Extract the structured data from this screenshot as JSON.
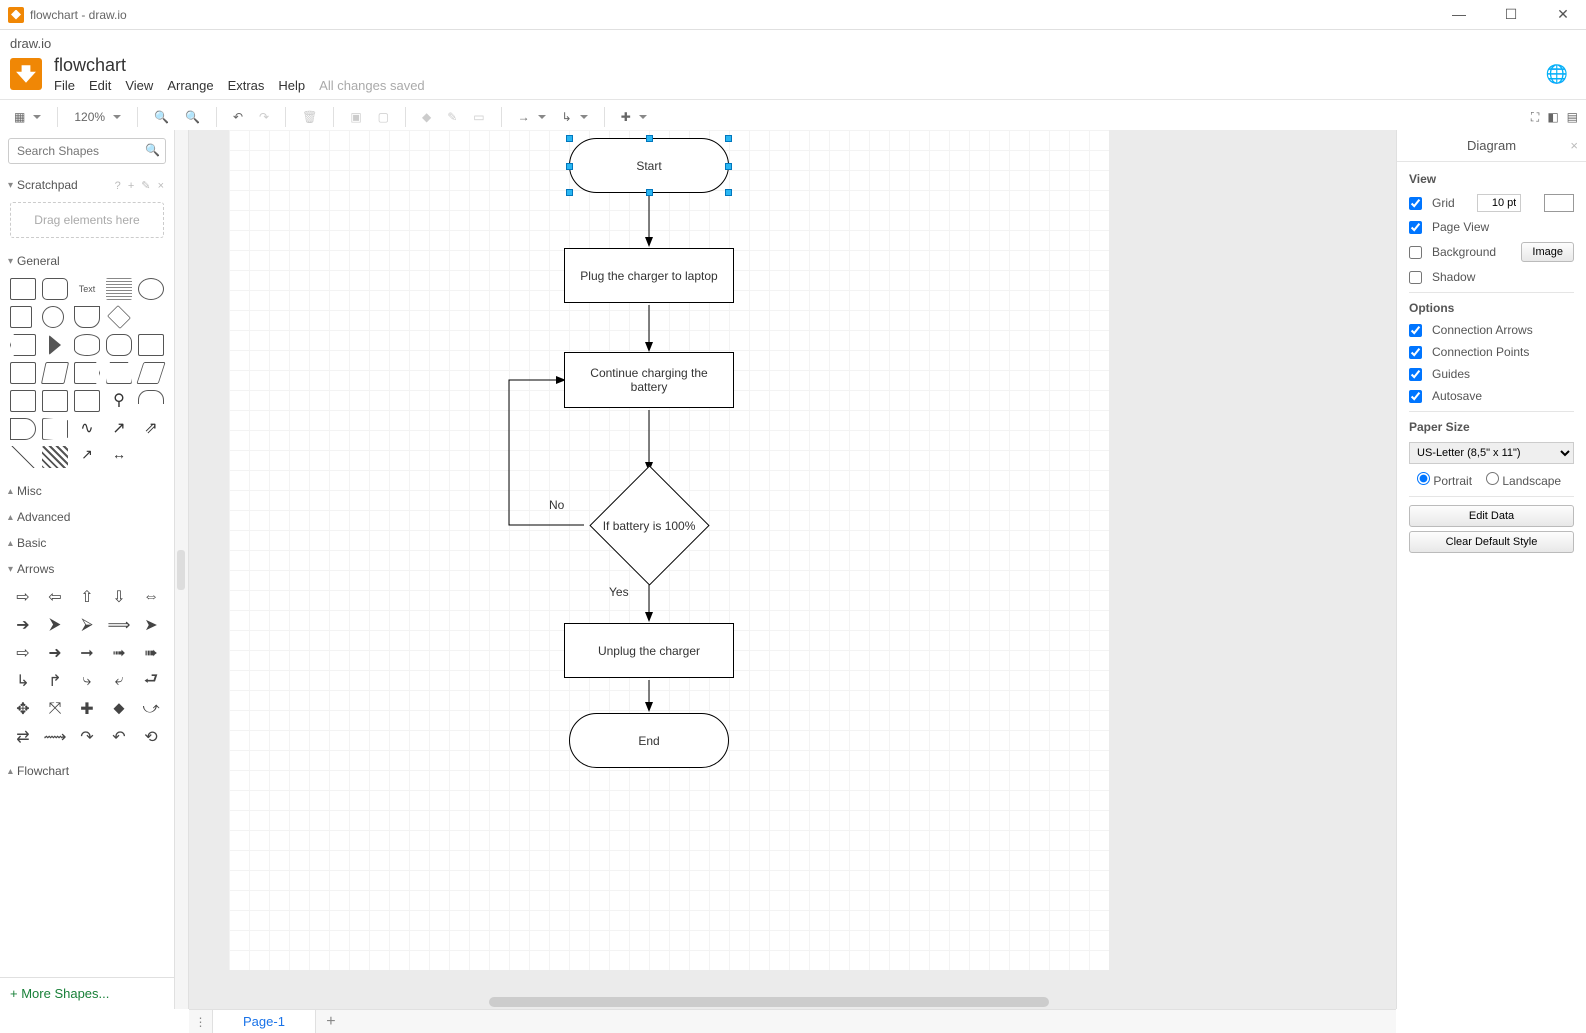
{
  "window": {
    "title": "flowchart - draw.io"
  },
  "breadcrumb": "draw.io",
  "document": {
    "title": "flowchart"
  },
  "menu": {
    "items": [
      "File",
      "Edit",
      "View",
      "Arrange",
      "Extras",
      "Help"
    ],
    "saved": "All changes saved"
  },
  "toolbar": {
    "zoom": "120%"
  },
  "sidebar": {
    "search_placeholder": "Search Shapes",
    "scratchpad": {
      "label": "Scratchpad",
      "hint": "Drag elements here",
      "tools": "? + ✎ ×"
    },
    "sections": {
      "general": "General",
      "misc": "Misc",
      "advanced": "Advanced",
      "basic": "Basic",
      "arrows": "Arrows",
      "flowchart": "Flowchart"
    },
    "more_shapes": "More Shapes..."
  },
  "diagram": {
    "nodes": {
      "start": "Start",
      "plug": "Plug the charger to laptop",
      "continue": "Continue charging the battery",
      "decision": "If battery is 100%",
      "unplug": "Unplug the charger",
      "end": "End"
    },
    "labels": {
      "no": "No",
      "yes": "Yes"
    }
  },
  "right_panel": {
    "title": "Diagram",
    "view": {
      "heading": "View",
      "grid": "Grid",
      "grid_value": "10 pt",
      "page_view": "Page View",
      "background": "Background",
      "image_btn": "Image",
      "shadow": "Shadow"
    },
    "options": {
      "heading": "Options",
      "conn_arrows": "Connection Arrows",
      "conn_points": "Connection Points",
      "guides": "Guides",
      "autosave": "Autosave"
    },
    "paper": {
      "heading": "Paper Size",
      "value": "US-Letter (8,5\" x 11\")",
      "portrait": "Portrait",
      "landscape": "Landscape"
    },
    "buttons": {
      "edit_data": "Edit Data",
      "clear_style": "Clear Default Style"
    }
  },
  "tabs": {
    "page1": "Page-1"
  }
}
